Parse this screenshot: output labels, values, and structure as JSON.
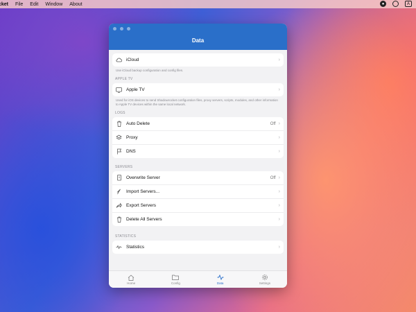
{
  "menubar": {
    "app_name": "cket",
    "menus": [
      "File",
      "Edit",
      "Window",
      "About"
    ]
  },
  "window": {
    "title": "Data",
    "sections": {
      "icloud": {
        "label": "iCloud",
        "footnote": "Use iCloud backup configuration and config files."
      },
      "apple_tv": {
        "header": "APPLE TV",
        "label": "Apple TV",
        "footnote": "Used for iOS devices to send Shadowrocket configuration files, proxy servers, scripts, modules, and other information to Apple TV devices within the same local network."
      },
      "logs": {
        "header": "LOGS",
        "items": [
          {
            "label": "Auto Delete",
            "value": "Off",
            "icon": "trash-icon"
          },
          {
            "label": "Proxy",
            "value": "",
            "icon": "layers-icon"
          },
          {
            "label": "DNS",
            "value": "",
            "icon": "flag-icon"
          }
        ]
      },
      "servers": {
        "header": "SERVERS",
        "items": [
          {
            "label": "Overwrite Server",
            "value": "Off",
            "icon": "document-icon"
          },
          {
            "label": "Import Servers...",
            "value": "",
            "icon": "import-icon"
          },
          {
            "label": "Export Servers",
            "value": "",
            "icon": "share-icon"
          },
          {
            "label": "Delete All Servers",
            "value": "",
            "icon": "trash-icon"
          }
        ]
      },
      "statistics": {
        "header": "STATISTICS",
        "label": "Statistics"
      }
    },
    "tabs": [
      {
        "label": "Home",
        "icon": "home-icon"
      },
      {
        "label": "Config",
        "icon": "folder-icon"
      },
      {
        "label": "Data",
        "icon": "data-icon",
        "active": true
      },
      {
        "label": "Settings",
        "icon": "gear-icon"
      }
    ],
    "accent": "#2a6fc9"
  }
}
